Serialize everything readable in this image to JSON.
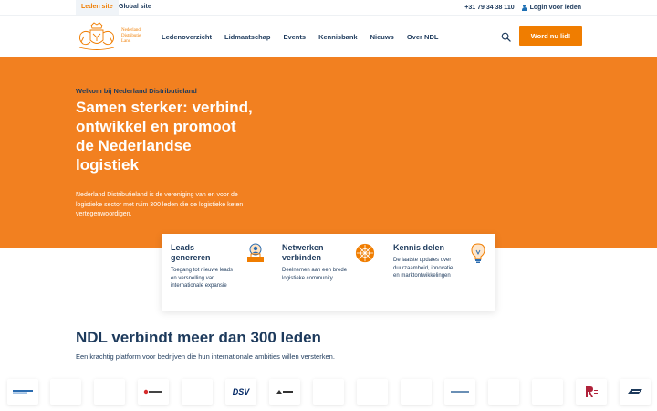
{
  "utility": {
    "tabs": [
      "Leden site",
      "Global site"
    ],
    "phone": "+31 79 34 38 110",
    "login": "Login voor leden"
  },
  "header": {
    "logo_text": [
      "Nederland",
      "Distributie",
      "Land"
    ],
    "nav": [
      "Ledenoverzicht",
      "Lidmaatschap",
      "Events",
      "Kennisbank",
      "Nieuws",
      "Over NDL"
    ],
    "cta": "Word nu lid!"
  },
  "hero": {
    "kicker": "Welkom bij Nederland Distributieland",
    "title": "Samen sterker: verbind, ontwikkel en promoot de Nederlandse logistiek",
    "description": "Nederland Distributieland is de vereniging van en voor de logistieke sector met ruim 300 leden die de logistieke keten vertegenwoordigen."
  },
  "features": [
    {
      "title": "Leads genereren",
      "desc": "Toegang tot nieuwe leads en versnelling van internationale expansie",
      "icon": "leads-icon"
    },
    {
      "title": "Netwerken verbinden",
      "desc": "Deelnemen aan een brede logistieke community",
      "icon": "network-icon"
    },
    {
      "title": "Kennis delen",
      "desc": "De laatste updates over duurzaamheid, innovatie en marktontwikkelingen",
      "icon": "lightbulb-icon"
    }
  ],
  "members": {
    "title": "NDL verbindt meer dan 300 leden",
    "subtitle": "Een krachtig platform voor bedrijven die hun internationale ambities willen versterken.",
    "logos": [
      "DSV"
    ]
  },
  "colors": {
    "orange": "#f07d00",
    "navy": "#1d3a5c",
    "hero_bg": "#f28020"
  }
}
